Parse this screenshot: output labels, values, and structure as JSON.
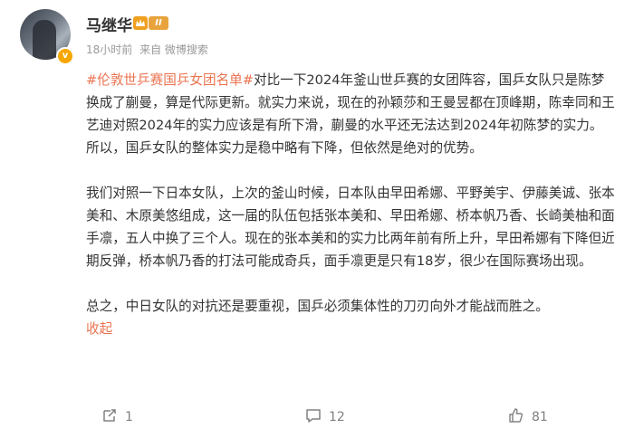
{
  "post": {
    "author": "马继华",
    "level_badge": "II",
    "time": "18小时前",
    "source": "来自 微博搜索",
    "topic": "#伦敦世乒赛国乒女团名单#",
    "paragraph1_text": "对比一下2024年釜山世乒赛的女团阵容，国乒女队只是陈梦换成了蒯曼，算是代际更新。就实力来说，现在的孙颖莎和王曼昱都在顶峰期，陈幸同和王艺迪对照2024年的实力应该是有所下滑，蒯曼的水平还无法达到2024年初陈梦的实力。所以，国乒女队的整体实力是稳中略有下降，但依然是绝对的优势。",
    "paragraph2": "我们对照一下日本女队，上次的釜山时候，日本队由早田希娜、平野美宇、伊藤美诚、张本美和、木原美悠组成，这一届的队伍包括张本美和、早田希娜、桥本帆乃香、长崎美柚和面手凛，五人中换了三个人。现在的张本美和的实力比两年前有所上升，早田希娜有下降但近期反弹，桥本帆乃香的打法可能成奇兵，面手凛更是只有18岁，很少在国际赛场出现。",
    "paragraph3": "总之，中日女队的对抗还是要重视，国乒必须集体性的刀刃向外才能战而胜之。",
    "collapse_label": "收起"
  },
  "actions": {
    "repost_count": "1",
    "comment_count": "12",
    "like_count": "81"
  },
  "colors": {
    "accent": "#eb7350",
    "meta_text": "#999999",
    "body_text": "#333333",
    "action_text": "#808080"
  },
  "icons": [
    "verified-badge-icon",
    "crown-icon",
    "repost-icon",
    "comment-icon",
    "like-icon"
  ]
}
